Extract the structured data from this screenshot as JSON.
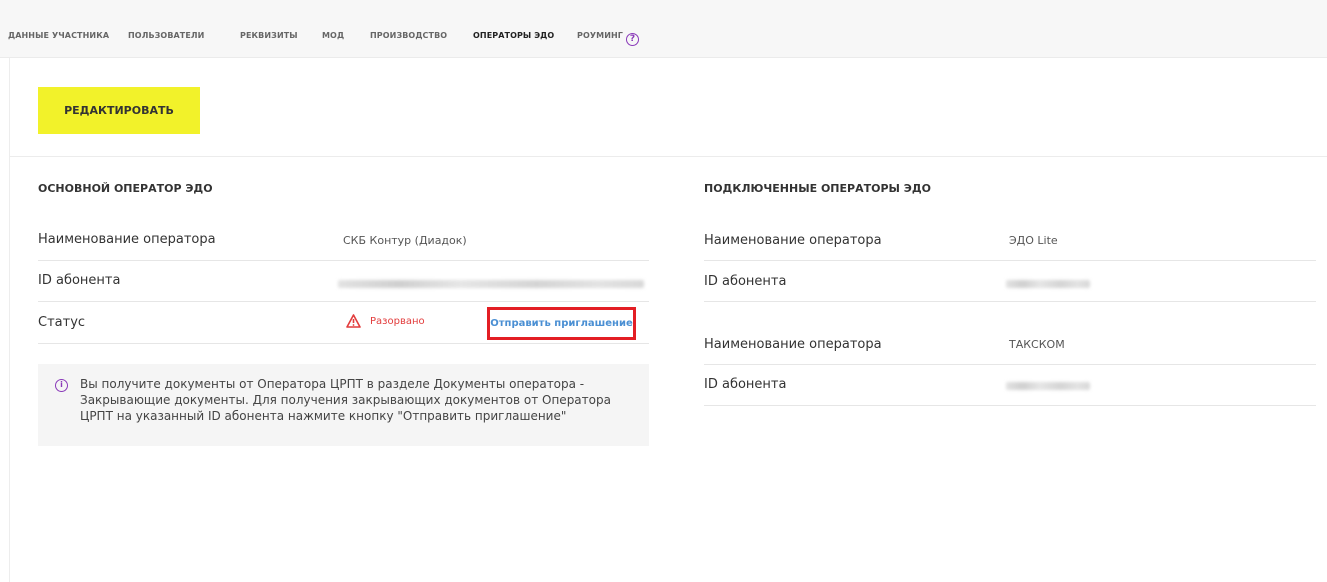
{
  "tabs": [
    {
      "label": "ДАННЫЕ УЧАСТНИКА",
      "active": false
    },
    {
      "label": "ПОЛЬЗОВАТЕЛИ",
      "active": false
    },
    {
      "label": "РЕКВИЗИТЫ",
      "active": false
    },
    {
      "label": "МОД",
      "active": false
    },
    {
      "label": "ПРОИЗВОДСТВО",
      "active": false
    },
    {
      "label": "ОПЕРАТОРЫ ЭДО",
      "active": true
    },
    {
      "label": "РОУМИНГ",
      "active": false,
      "icon": "help-circle-icon"
    }
  ],
  "edit_button": {
    "label": "РЕДАКТИРОВАТЬ",
    "color": "#f2f22a"
  },
  "main_operator": {
    "title": "ОСНОВНОЙ ОПЕРАТОР ЭДО",
    "rows": [
      {
        "label": "Наименование оператора",
        "value": "СКБ Контур (Диадок)"
      },
      {
        "label": "ID абонента",
        "value": ""
      },
      {
        "label": "Статус",
        "value": "Разорвано",
        "status_color": "#e23c3c",
        "status_icon": "warning-triangle-icon"
      }
    ],
    "invite_link": "Отправить приглашение",
    "info": {
      "icon": "info-circle-icon",
      "text": "Вы получите документы от Оператора ЦРПТ в разделе Документы оператора - Закрывающие документы. Для получения закрывающих документов от Оператора ЦРПТ на указанный ID абонента нажмите кнопку \"Отправить приглашение\""
    }
  },
  "connected_operators": {
    "title": "ПОДКЛЮЧЕННЫЕ ОПЕРАТОРЫ ЭДО",
    "items": [
      {
        "name_label": "Наименование оператора",
        "name_value": "ЭДО Lite",
        "id_label": "ID абонента"
      },
      {
        "name_label": "Наименование оператора",
        "name_value": "ТАКСКОМ",
        "id_label": "ID абонента"
      }
    ]
  },
  "colors": {
    "accent": "#f2f22a",
    "link": "#4a8fd3",
    "error": "#e23c3c",
    "highlight": "#e31e24",
    "help": "#8a3ab9"
  }
}
